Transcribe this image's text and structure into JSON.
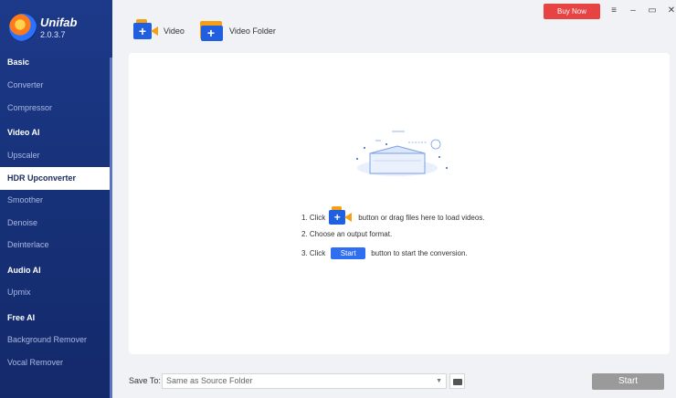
{
  "app": {
    "name": "Unifab",
    "version": "2.0.3.7"
  },
  "titlebar": {
    "buy_label": "Buy Now",
    "menu_icon": "≡",
    "minimize_icon": "–",
    "maximize_icon": "▭",
    "close_icon": "✕",
    "buy_color": "#e84343"
  },
  "sidebar": {
    "sections": [
      {
        "label": "Basic"
      },
      {
        "label": "Video AI"
      },
      {
        "label": "Audio AI"
      },
      {
        "label": "Free AI"
      }
    ],
    "items": [
      {
        "label": "Converter"
      },
      {
        "label": "Compressor"
      },
      {
        "label": "Upscaler"
      },
      {
        "label": "HDR Upconverter",
        "active": true
      },
      {
        "label": "Smoother"
      },
      {
        "label": "Denoise"
      },
      {
        "label": "Deinterlace"
      },
      {
        "label": "Upmix"
      },
      {
        "label": "Background Remover"
      },
      {
        "label": "Vocal Remover"
      }
    ]
  },
  "toolbar": {
    "video_label": "Video",
    "folder_label": "Video Folder"
  },
  "instructions": {
    "step1_prefix": "1. Click",
    "step1_suffix": "button or drag files here to load videos.",
    "step2": "2. Choose an output format.",
    "step3_prefix": "3. Click",
    "step3_chip": "Start",
    "step3_suffix": "button to start the conversion."
  },
  "footer": {
    "save_to_label": "Save To:",
    "save_to_value": "Same as Source Folder",
    "start_label": "Start"
  }
}
